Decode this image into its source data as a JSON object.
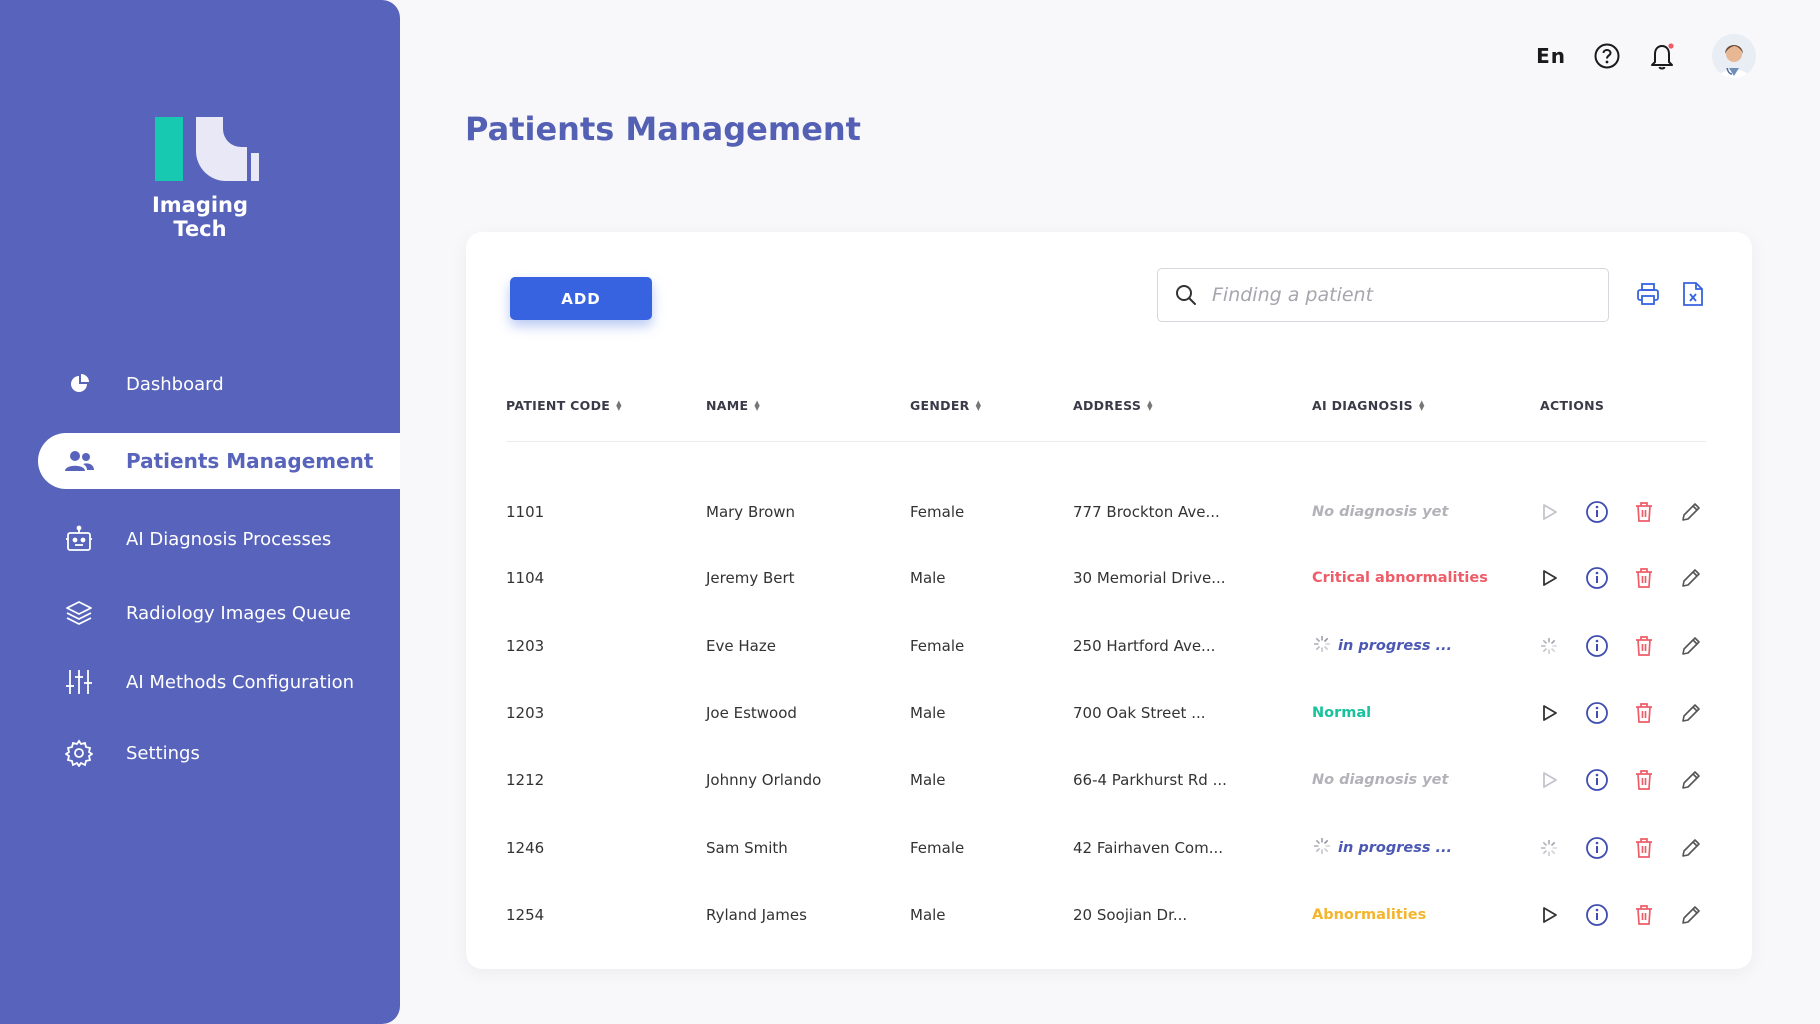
{
  "brand": {
    "name": "Imaging Tech"
  },
  "sidebar": {
    "items": [
      {
        "label": "Dashboard",
        "icon": "pie-chart-icon",
        "active": false
      },
      {
        "label": "Patients Management",
        "icon": "users-icon",
        "active": true
      },
      {
        "label": "AI Diagnosis Processes",
        "icon": "robot-icon",
        "active": false
      },
      {
        "label": "Radiology Images Queue",
        "icon": "layers-icon",
        "active": false
      },
      {
        "label": "AI Methods Configuration",
        "icon": "sliders-icon",
        "active": false
      },
      {
        "label": "Settings",
        "icon": "gear-icon",
        "active": false
      }
    ]
  },
  "header": {
    "language": "En",
    "icons": [
      "help-icon",
      "bell-icon",
      "avatar"
    ]
  },
  "page": {
    "title": "Patients Management"
  },
  "toolbar": {
    "add_label": "ADD",
    "search_placeholder": "Finding a patient",
    "search_value": "",
    "icons": [
      "print-icon",
      "export-excel-icon"
    ]
  },
  "table": {
    "columns": [
      "PATIENT CODE",
      "NAME",
      "GENDER",
      "ADDRESS",
      "AI DIAGNOSIS",
      "ACTIONS"
    ],
    "rows": [
      {
        "code": "1101",
        "name": "Mary Brown",
        "gender": "Female",
        "address": "777 Brockton Ave...",
        "diagnosis": "No diagnosis yet",
        "status": "none"
      },
      {
        "code": "1104",
        "name": "Jeremy Bert",
        "gender": "Male",
        "address": "30 Memorial Drive...",
        "diagnosis": "Critical abnormalities",
        "status": "critical"
      },
      {
        "code": "1203",
        "name": "Eve Haze",
        "gender": "Female",
        "address": "250 Hartford Ave...",
        "diagnosis": "in progress ...",
        "status": "progress"
      },
      {
        "code": "1203",
        "name": "Joe Estwood",
        "gender": "Male",
        "address": "700 Oak Street ...",
        "diagnosis": "Normal",
        "status": "normal"
      },
      {
        "code": "1212",
        "name": "Johnny Orlando",
        "gender": "Male",
        "address": "66-4 Parkhurst Rd ...",
        "diagnosis": "No diagnosis yet",
        "status": "none"
      },
      {
        "code": "1246",
        "name": "Sam Smith",
        "gender": "Female",
        "address": "42 Fairhaven Com...",
        "diagnosis": "in progress ...",
        "status": "progress"
      },
      {
        "code": "1254",
        "name": "Ryland James",
        "gender": "Male",
        "address": "20 Soojian Dr...",
        "diagnosis": "Abnormalities",
        "status": "abn"
      }
    ]
  },
  "colors": {
    "sidebar": "#5864bb",
    "accent": "#3763e0",
    "title": "#5460b4",
    "critical": "#ee5c68",
    "normal": "#17c29d",
    "abnormal": "#f3b52e",
    "delete": "#ee5c68"
  }
}
